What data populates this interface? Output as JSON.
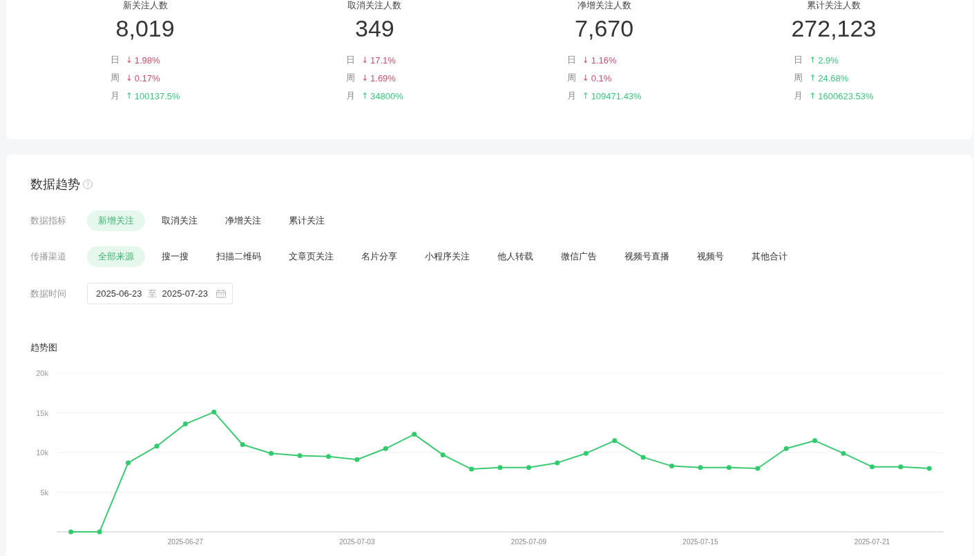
{
  "stats": [
    {
      "label": "新关注人数",
      "value": "8,019",
      "changes": [
        {
          "period": "日",
          "arrow": "↓",
          "percent": "1.98%",
          "color": "#c8506e"
        },
        {
          "period": "周",
          "arrow": "↓",
          "percent": "0.17%",
          "color": "#c8506e"
        },
        {
          "period": "月",
          "arrow": "↑",
          "percent": "100137.5%",
          "color": "#3cc47c"
        }
      ]
    },
    {
      "label": "取消关注人数",
      "value": "349",
      "changes": [
        {
          "period": "日",
          "arrow": "↓",
          "percent": "17.1%",
          "color": "#c8506e"
        },
        {
          "period": "周",
          "arrow": "↓",
          "percent": "1.69%",
          "color": "#c8506e"
        },
        {
          "period": "月",
          "arrow": "↑",
          "percent": "34800%",
          "color": "#3cc47c"
        }
      ]
    },
    {
      "label": "净增关注人数",
      "value": "7,670",
      "changes": [
        {
          "period": "日",
          "arrow": "↓",
          "percent": "1.16%",
          "color": "#c8506e"
        },
        {
          "period": "周",
          "arrow": "↓",
          "percent": "0.1%",
          "color": "#c8506e"
        },
        {
          "period": "月",
          "arrow": "↑",
          "percent": "109471.43%",
          "color": "#3cc47c"
        }
      ]
    },
    {
      "label": "累计关注人数",
      "value": "272,123",
      "changes": [
        {
          "period": "日",
          "arrow": "↑",
          "percent": "2.9%",
          "color": "#3cc47c"
        },
        {
          "period": "周",
          "arrow": "↑",
          "percent": "24.68%",
          "color": "#3cc47c"
        },
        {
          "period": "月",
          "arrow": "↑",
          "percent": "1600623.53%",
          "color": "#3cc47c"
        }
      ]
    }
  ],
  "trend": {
    "title": "数据趋势",
    "filters": [
      {
        "label": "数据指标",
        "options": [
          {
            "label": "新增关注",
            "selected": true
          },
          {
            "label": "取消关注",
            "selected": false
          },
          {
            "label": "净增关注",
            "selected": false
          },
          {
            "label": "累计关注",
            "selected": false
          }
        ]
      },
      {
        "label": "传播渠道",
        "options": [
          {
            "label": "全部来源",
            "selected": true
          },
          {
            "label": "搜一搜",
            "selected": false
          },
          {
            "label": "扫描二维码",
            "selected": false
          },
          {
            "label": "文章页关注",
            "selected": false
          },
          {
            "label": "名片分享",
            "selected": false
          },
          {
            "label": "小程序关注",
            "selected": false
          },
          {
            "label": "他人转载",
            "selected": false
          },
          {
            "label": "微信广告",
            "selected": false
          },
          {
            "label": "视频号直播",
            "selected": false
          },
          {
            "label": "视频号",
            "selected": false
          },
          {
            "label": "其他合计",
            "selected": false
          }
        ]
      }
    ],
    "date_range": {
      "label": "数据时间",
      "start": "2025-06-23",
      "separator": "至",
      "end": "2025-07-23"
    },
    "chart_title": "趋势图",
    "chart_data": {
      "type": "line",
      "categories": [
        null,
        null,
        null,
        null,
        "2025-06-27",
        null,
        null,
        null,
        null,
        null,
        "2025-07-03",
        null,
        null,
        null,
        null,
        null,
        "2025-07-09",
        null,
        null,
        null,
        null,
        null,
        "2025-07-15",
        null,
        null,
        null,
        null,
        null,
        "2025-07-21",
        null,
        null
      ],
      "values": [
        0,
        0,
        8700,
        10800,
        13600,
        15100,
        11000,
        9900,
        9600,
        9500,
        9100,
        10500,
        12300,
        9700,
        7900,
        8100,
        8100,
        8700,
        9900,
        11500,
        9400,
        8300,
        8100,
        8100,
        8000,
        10500,
        11500,
        9900,
        8200,
        8200,
        8000
      ],
      "ylim": [
        0,
        20000
      ],
      "yticks": [
        {
          "value": 5000,
          "label": "5k"
        },
        {
          "value": 10000,
          "label": "10k"
        },
        {
          "value": 15000,
          "label": "15k"
        },
        {
          "value": 20000,
          "label": "20k"
        }
      ],
      "grid": true,
      "marker": "circle"
    }
  }
}
